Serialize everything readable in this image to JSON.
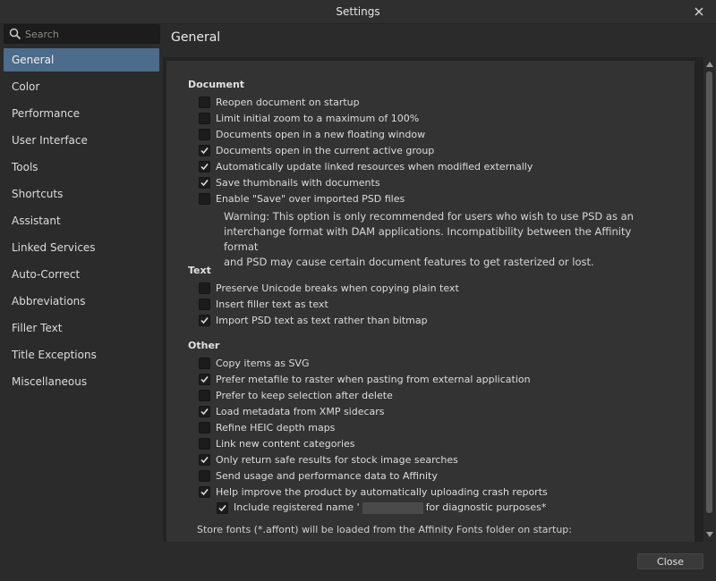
{
  "window": {
    "title": "Settings"
  },
  "search": {
    "placeholder": "Search",
    "value": ""
  },
  "sidebar": {
    "items": [
      {
        "label": "General"
      },
      {
        "label": "Color"
      },
      {
        "label": "Performance"
      },
      {
        "label": "User Interface"
      },
      {
        "label": "Tools"
      },
      {
        "label": "Shortcuts"
      },
      {
        "label": "Assistant"
      },
      {
        "label": "Linked Services"
      },
      {
        "label": "Auto-Correct"
      },
      {
        "label": "Abbreviations"
      },
      {
        "label": "Filler Text"
      },
      {
        "label": "Title Exceptions"
      },
      {
        "label": "Miscellaneous"
      }
    ],
    "active": "General"
  },
  "panel": {
    "title": "General"
  },
  "document": {
    "heading": "Document",
    "options": [
      {
        "label": "Reopen document on startup",
        "checked": false
      },
      {
        "label": "Limit initial zoom to a maximum of 100%",
        "checked": false
      },
      {
        "label": "Documents open in a new floating window",
        "checked": false
      },
      {
        "label": "Documents open in the current active group",
        "checked": true
      },
      {
        "label": "Automatically update linked resources when modified externally",
        "checked": true
      },
      {
        "label": "Save thumbnails with documents",
        "checked": true
      },
      {
        "label": "Enable \"Save\" over imported PSD files",
        "checked": false
      }
    ],
    "warning_lines": [
      "Warning: This option is only recommended for users who wish to use PSD as an",
      "interchange format with DAM applications. Incompatibility between the Affinity format",
      "and PSD may cause certain document features to get rasterized or lost."
    ]
  },
  "text": {
    "heading": "Text",
    "options": [
      {
        "label": "Preserve Unicode breaks when copying plain text",
        "checked": false
      },
      {
        "label": "Insert filler text as text",
        "checked": false
      },
      {
        "label": "Import PSD text as text rather than bitmap",
        "checked": true
      }
    ]
  },
  "other": {
    "heading": "Other",
    "options": [
      {
        "label": "Copy items as SVG",
        "checked": false
      },
      {
        "label": "Prefer metafile to raster when pasting from external application",
        "checked": true
      },
      {
        "label": "Prefer to keep selection after delete",
        "checked": false
      },
      {
        "label": "Load metadata from XMP sidecars",
        "checked": true
      },
      {
        "label": "Refine HEIC depth maps",
        "checked": false
      },
      {
        "label": "Link new content categories",
        "checked": false
      },
      {
        "label": "Only return safe results for stock image searches",
        "checked": true
      },
      {
        "label": "Send usage and performance data to Affinity",
        "checked": false
      },
      {
        "label": "Help improve the product by automatically uploading crash reports",
        "checked": true
      }
    ],
    "sub_option": {
      "label_before": "Include registered name '",
      "label_after": "for diagnostic purposes*",
      "checked": true
    }
  },
  "fonts_note": "Store fonts (*.affont) will be loaded from the Affinity Fonts folder on startup:",
  "footer": {
    "close_label": "Close"
  },
  "colors": {
    "accent": "#4d6b8a",
    "background": "#2b2b2b",
    "panel": "#333333"
  }
}
